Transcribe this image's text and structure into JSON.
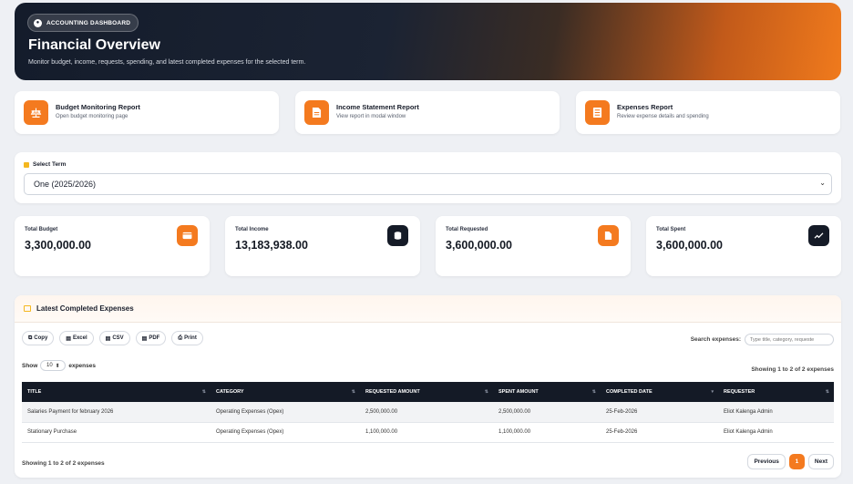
{
  "hero": {
    "badge": "ACCOUNTING DASHBOARD",
    "title": "Financial Overview",
    "subtitle": "Monitor budget, income, requests, spending, and latest completed expenses for the selected term."
  },
  "reports": [
    {
      "title": "Budget Monitoring Report",
      "desc": "Open budget monitoring page",
      "icon": "scale-icon"
    },
    {
      "title": "Income Statement Report",
      "desc": "View report in modal window",
      "icon": "file-icon"
    },
    {
      "title": "Expenses Report",
      "desc": "Review expense details and spending",
      "icon": "receipt-icon"
    }
  ],
  "term": {
    "label": "Select Term",
    "value": "One (2025/2026)"
  },
  "stats": [
    {
      "label": "Total Budget",
      "value": "3,300,000.00",
      "icon": "wallet-icon"
    },
    {
      "label": "Total Income",
      "value": "13,183,938.00",
      "icon": "coins-icon"
    },
    {
      "label": "Total Requested",
      "value": "3,600,000.00",
      "icon": "document-icon"
    },
    {
      "label": "Total Spent",
      "value": "3,600,000.00",
      "icon": "chart-line-icon"
    }
  ],
  "expenses": {
    "title": "Latest Completed Expenses",
    "buttons": [
      "Copy",
      "Excel",
      "CSV",
      "PDF",
      "Print"
    ],
    "search_label": "Search expenses:",
    "search_placeholder": "Type title, category, requeste",
    "show_label": "Show",
    "show_value": "10",
    "show_suffix": "expenses",
    "info": "Showing 1 to 2 of 2 expenses",
    "columns": [
      "TITLE",
      "CATEGORY",
      "REQUESTED AMOUNT",
      "SPENT AMOUNT",
      "COMPLETED DATE",
      "REQUESTER"
    ],
    "rows": [
      [
        "Salaries Payment for february 2026",
        "Operating Expenses (Opex)",
        "2,500,000.00",
        "2,500,000.00",
        "25-Feb-2026",
        "Eliot Kalenga Admin"
      ],
      [
        "Stationary Purchase",
        "Operating Expenses (Opex)",
        "1,100,000.00",
        "1,100,000.00",
        "25-Feb-2026",
        "Eliot Kalenga Admin"
      ]
    ],
    "pager": {
      "prev": "Previous",
      "current": "1",
      "next": "Next"
    }
  },
  "colors": {
    "accent": "#f47a1f",
    "dark": "#141a26"
  }
}
